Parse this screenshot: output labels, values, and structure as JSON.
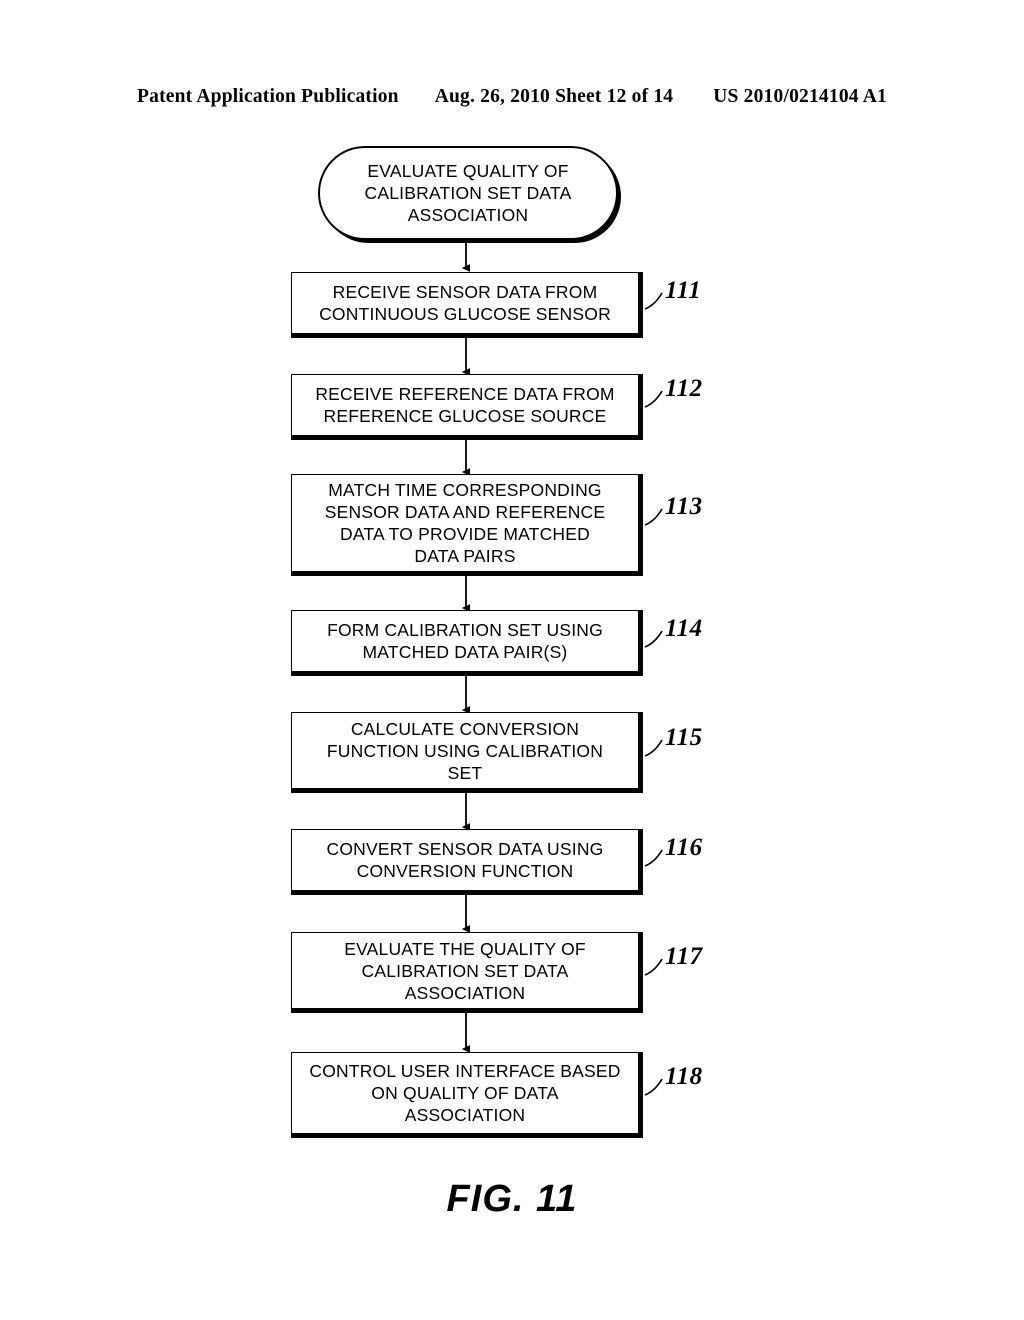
{
  "header": {
    "left": "Patent Application Publication",
    "middle": "Aug. 26, 2010  Sheet 12 of 14",
    "right": "US 2010/0214104 A1"
  },
  "figure": {
    "caption": "FIG. 11"
  },
  "flowchart": {
    "nodes": [
      {
        "id": "start",
        "shape": "terminator",
        "text": "EVALUATE QUALITY OF\nCALIBRATION SET DATA\nASSOCIATION",
        "ref": ""
      },
      {
        "id": "step-111",
        "shape": "process",
        "text": "RECEIVE SENSOR DATA FROM\nCONTINUOUS GLUCOSE SENSOR",
        "ref": "111"
      },
      {
        "id": "step-112",
        "shape": "process",
        "text": "RECEIVE REFERENCE DATA FROM\nREFERENCE GLUCOSE SOURCE",
        "ref": "112"
      },
      {
        "id": "step-113",
        "shape": "process",
        "text": "MATCH TIME CORRESPONDING\nSENSOR DATA AND REFERENCE\nDATA TO PROVIDE MATCHED\nDATA PAIRS",
        "ref": "113"
      },
      {
        "id": "step-114",
        "shape": "process",
        "text": "FORM CALIBRATION SET USING\nMATCHED DATA PAIR(S)",
        "ref": "114"
      },
      {
        "id": "step-115",
        "shape": "process",
        "text": "CALCULATE CONVERSION\nFUNCTION USING CALIBRATION\nSET",
        "ref": "115"
      },
      {
        "id": "step-116",
        "shape": "process",
        "text": "CONVERT SENSOR DATA USING\nCONVERSION FUNCTION",
        "ref": "116"
      },
      {
        "id": "step-117",
        "shape": "process",
        "text": "EVALUATE THE QUALITY OF\nCALIBRATION SET DATA\nASSOCIATION",
        "ref": "117"
      },
      {
        "id": "step-118",
        "shape": "process",
        "text": "CONTROL USER INTERFACE BASED\nON QUALITY OF DATA\nASSOCIATION",
        "ref": "118"
      }
    ],
    "connector_count": 8,
    "colors": {
      "stroke": "#000000",
      "fill": "#ffffff"
    }
  }
}
